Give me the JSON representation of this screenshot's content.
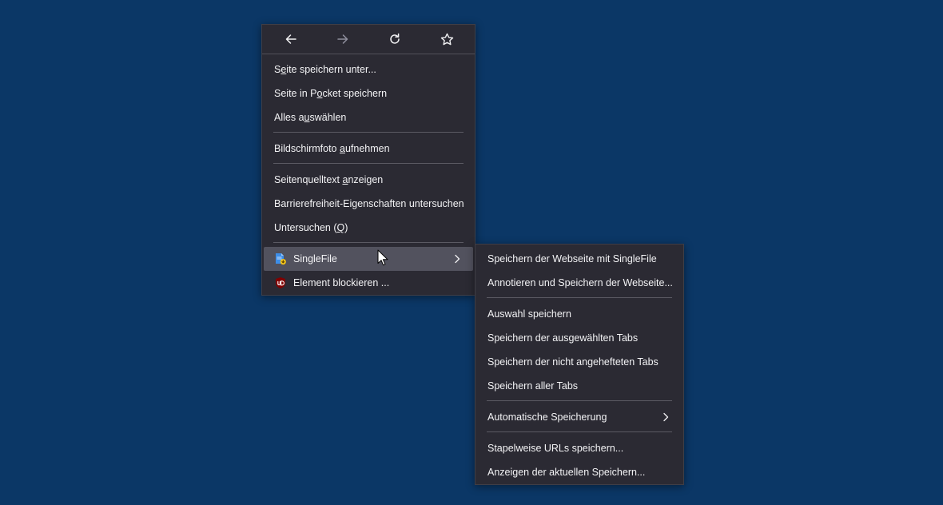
{
  "colors": {
    "desktop_background": "#0b3766",
    "menu_background": "#2b2a33",
    "highlight": "#52525e",
    "text": "#f3f3f5",
    "disabled_icon": "#8f8f9d",
    "ublock_red": "#800000"
  },
  "main_menu": {
    "nav": {
      "back_icon": "arrow-left-icon",
      "forward_icon": "arrow-right-icon",
      "reload_icon": "reload-icon",
      "bookmark_icon": "star-icon"
    },
    "items": {
      "save_page_as": {
        "pre": "S",
        "key": "e",
        "post": "ite speichern unter..."
      },
      "save_to_pocket": {
        "pre": "Seite in P",
        "key": "o",
        "post": "cket speichern"
      },
      "select_all": {
        "pre": "Alles a",
        "key": "u",
        "post": "swählen"
      },
      "screenshot": {
        "pre": "Bildschirmfoto ",
        "key": "a",
        "post": "ufnehmen"
      },
      "view_source": {
        "pre": "Seitenquelltext ",
        "key": "a",
        "post": "nzeigen"
      },
      "accessibility": {
        "label": "Barrierefreiheit-Eigenschaften untersuchen"
      },
      "inspect": {
        "pre": "Untersuchen (",
        "key": "Q",
        "post": ")"
      },
      "singlefile": {
        "label": "SingleFile",
        "icon": "singlefile-icon"
      },
      "block_element": {
        "label": "Element blockieren ...",
        "icon": "ublock-origin-icon"
      }
    }
  },
  "sub_menu": {
    "items": {
      "save_page": "Speichern der Webseite mit SingleFile",
      "annotate_save": "Annotieren und Speichern der Webseite...",
      "save_selection": "Auswahl speichern",
      "save_selected_tabs": "Speichern der ausgewählten Tabs",
      "save_unpinned_tabs": "Speichern der nicht angehefteten Tabs",
      "save_all_tabs": "Speichern aller Tabs",
      "auto_save": "Automatische Speicherung",
      "batch_urls": "Stapelweise URLs speichern...",
      "pending_saves": "Anzeigen der aktuellen Speichern..."
    }
  }
}
